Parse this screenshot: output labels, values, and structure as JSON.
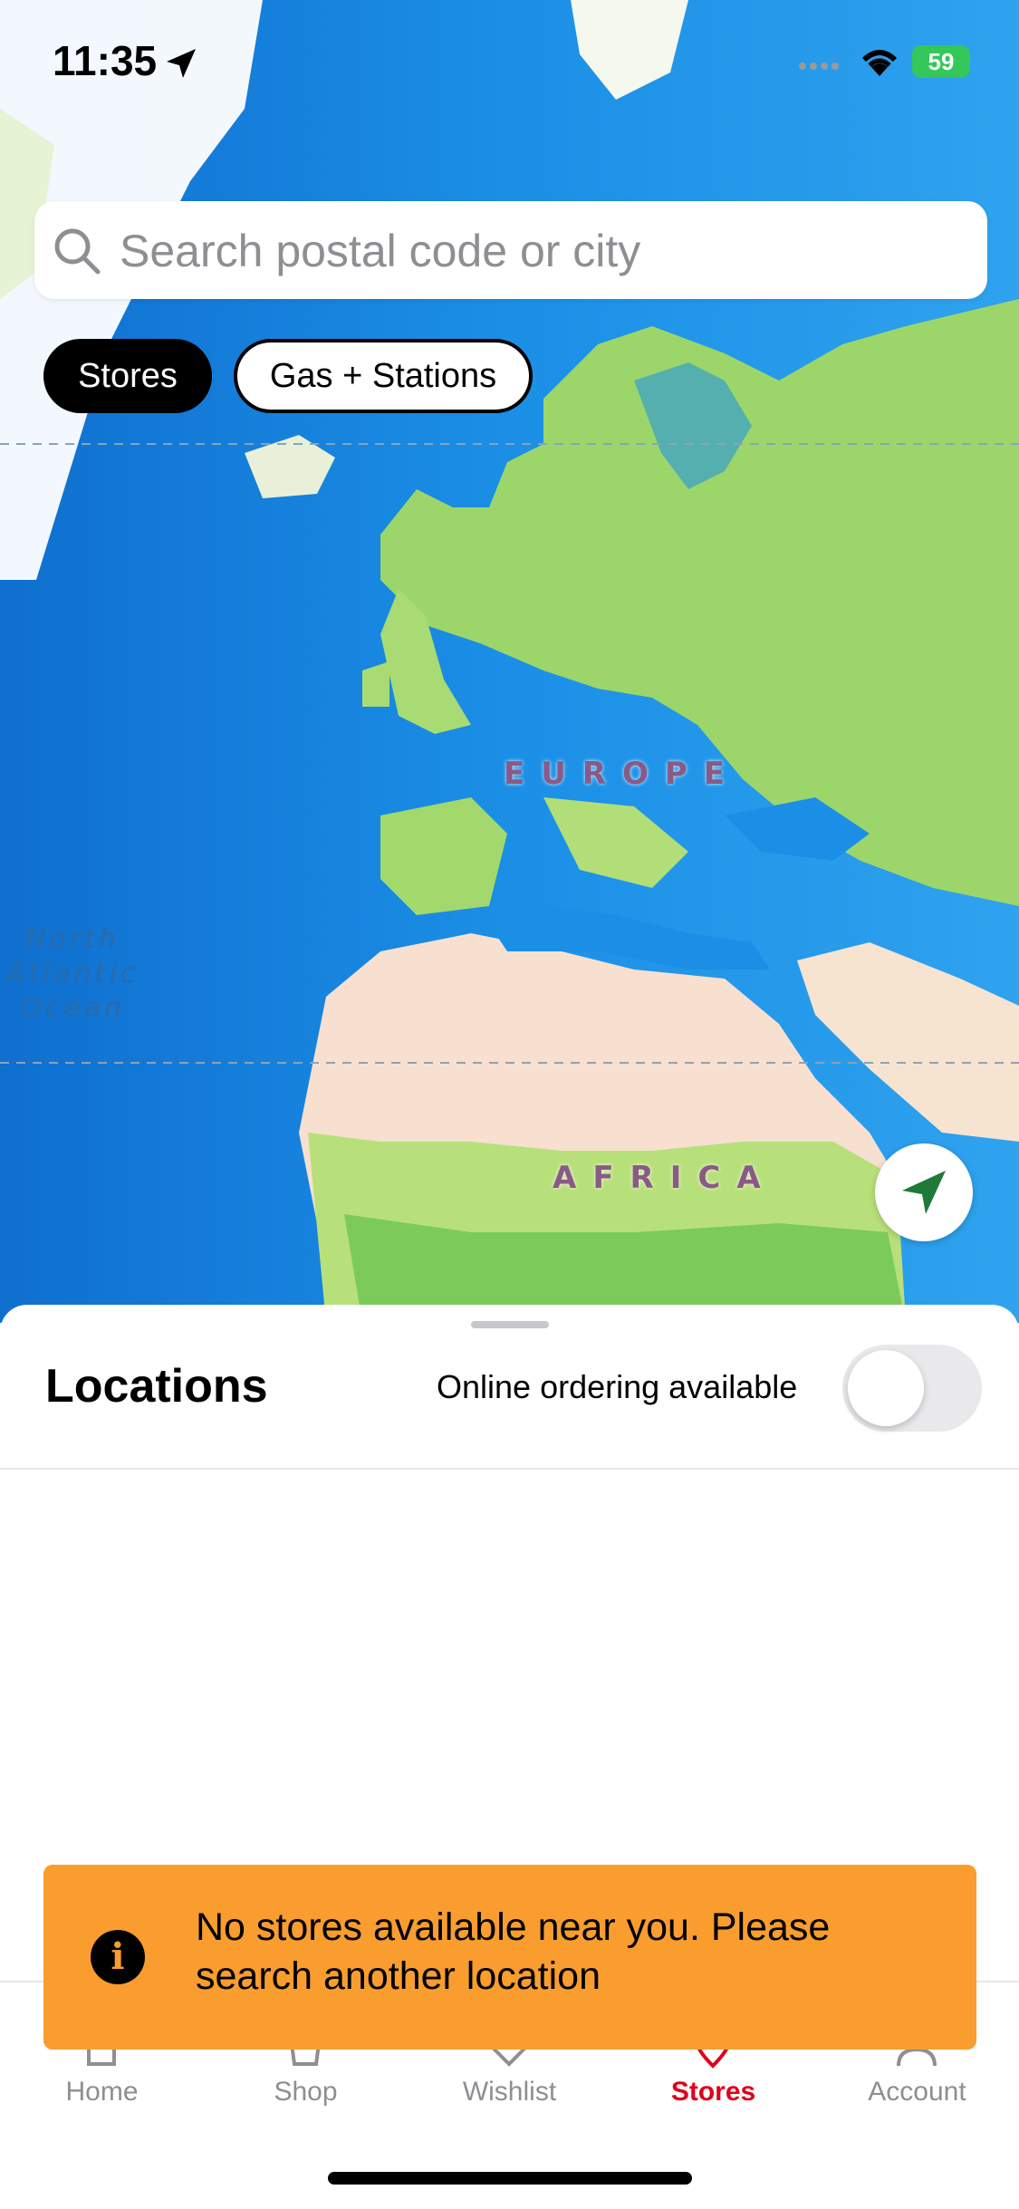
{
  "status_bar": {
    "time": "11:35",
    "battery": "59"
  },
  "search": {
    "placeholder": "Search postal code or city"
  },
  "filters": [
    {
      "label": "Stores",
      "active": true
    },
    {
      "label": "Gas + Stations",
      "active": false
    }
  ],
  "map": {
    "labels": {
      "europe": "EUROPE",
      "africa": "AFRICA",
      "ocean": "North Atlantic Ocean"
    }
  },
  "sheet": {
    "title": "Locations",
    "online_toggle_label": "Online ordering available",
    "online_toggle_on": false
  },
  "toast": {
    "message": "No stores available near you. Please search another location"
  },
  "tabbar": {
    "items": [
      {
        "label": "Home",
        "icon": "home-icon"
      },
      {
        "label": "Shop",
        "icon": "shop-icon"
      },
      {
        "label": "Wishlist",
        "icon": "heart-icon"
      },
      {
        "label": "Stores",
        "icon": "store-icon",
        "active": true
      },
      {
        "label": "Account",
        "icon": "account-icon"
      }
    ]
  },
  "colors": {
    "accent": "#e0001b",
    "toast": "#f99d2f",
    "locate_arrow": "#1f7a3a"
  }
}
